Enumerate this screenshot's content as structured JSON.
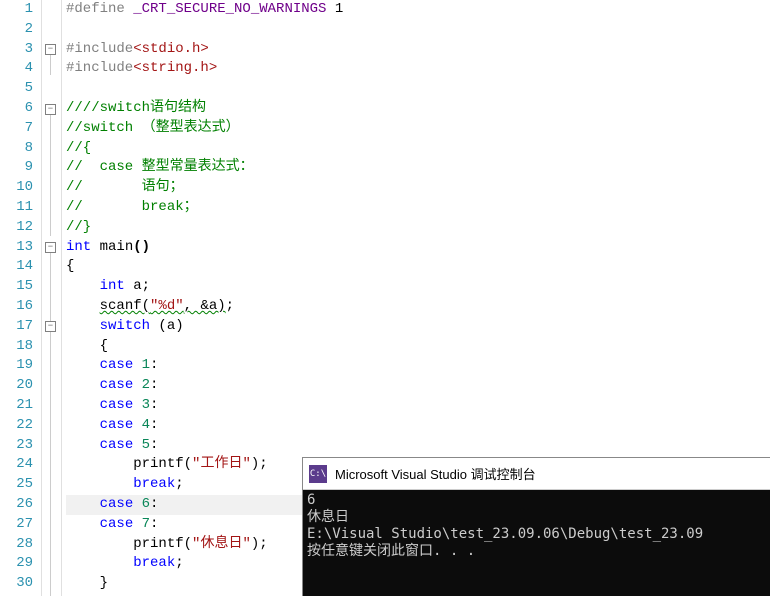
{
  "gutter": {
    "start": 1,
    "end": 30
  },
  "folds": [
    {
      "line": 3,
      "open": true
    },
    {
      "line": 6,
      "open": true
    },
    {
      "line": 13,
      "open": true
    },
    {
      "line": 17,
      "open": true
    }
  ],
  "code": {
    "l1": {
      "pp": "#define ",
      "macro": "_CRT_SECURE_NO_WARNINGS",
      "rest": " 1"
    },
    "l3": {
      "pp": "#include",
      "path": "<stdio.h>"
    },
    "l4": {
      "pp": "#include",
      "path": "<string.h>"
    },
    "l6": "////switch语句结构",
    "l7": "//switch （整型表达式）",
    "l8": "//{",
    "l9": "//  case 整型常量表达式：",
    "l10": "//       语句；",
    "l11": "//       break；",
    "l12": "//}",
    "l13": {
      "type": "int",
      "name": " main",
      "paren": "()"
    },
    "l14": "{",
    "l15": {
      "indent": "    ",
      "type": "int",
      "rest": " a;"
    },
    "l16": {
      "indent": "    ",
      "fn": "scanf",
      "open": "(",
      "str": "\"%d\"",
      "rest": ", &a)",
      "semi": ";"
    },
    "l17": {
      "indent": "    ",
      "kw": "switch",
      "rest": " (a)"
    },
    "l18": "    {",
    "l19": {
      "indent": "    ",
      "kw": "case",
      "num": " 1",
      "rest": ":"
    },
    "l20": {
      "indent": "    ",
      "kw": "case",
      "num": " 2",
      "rest": ":"
    },
    "l21": {
      "indent": "    ",
      "kw": "case",
      "num": " 3",
      "rest": ":"
    },
    "l22": {
      "indent": "    ",
      "kw": "case",
      "num": " 4",
      "rest": ":"
    },
    "l23": {
      "indent": "    ",
      "kw": "case",
      "num": " 5",
      "rest": ":"
    },
    "l24": {
      "indent": "        ",
      "fn": "printf",
      "open": "(",
      "str": "\"工作日\"",
      "close": ");"
    },
    "l25": {
      "indent": "        ",
      "kw": "break",
      "rest": ";"
    },
    "l26": {
      "indent": "    ",
      "kw": "case",
      "num": " 6",
      "rest": ":"
    },
    "l27": {
      "indent": "    ",
      "kw": "case",
      "num": " 7",
      "rest": ":"
    },
    "l28": {
      "indent": "        ",
      "fn": "printf",
      "open": "(",
      "str": "\"休息日\"",
      "close": ");"
    },
    "l29": {
      "indent": "        ",
      "kw": "break",
      "rest": ";"
    },
    "l30": "    }"
  },
  "console": {
    "title": "Microsoft Visual Studio 调试控制台",
    "icon_text": "C:\\",
    "lines": {
      "c1": "6",
      "c2": "休息日",
      "c3": "E:\\Visual Studio\\test_23.09.06\\Debug\\test_23.09",
      "c4": "按任意键关闭此窗口. . ."
    }
  }
}
